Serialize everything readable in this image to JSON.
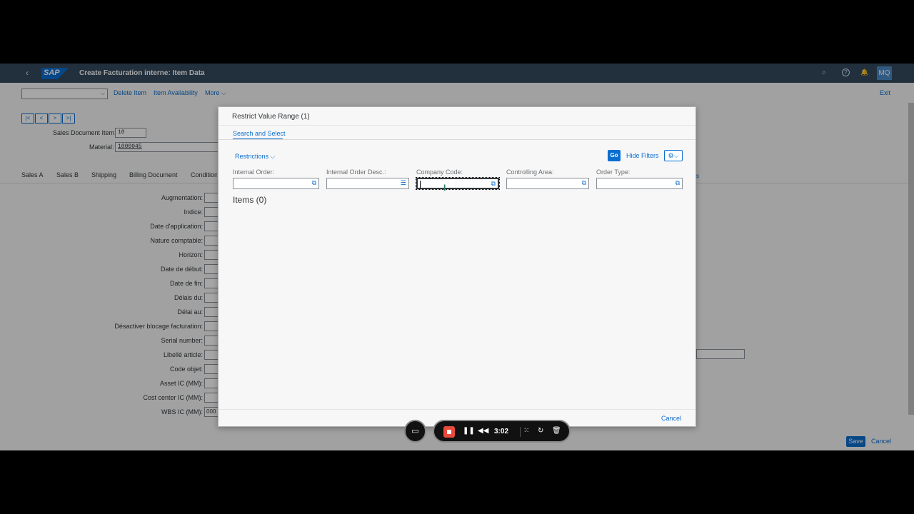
{
  "shell": {
    "back_icon": "‹",
    "logo": "SAP",
    "title": "Create Facturation interne: Item Data",
    "avatar": "MQ",
    "search_icon": "⌕",
    "help_icon": "?",
    "bell_icon": "🔔"
  },
  "toolbar": {
    "select_value": "",
    "buttons": [
      "Delete Item",
      "Item Availability",
      "More"
    ],
    "more_label": "More",
    "exit_label": "Exit"
  },
  "nav": {
    "first": "|<",
    "prev": "<",
    "next": ">",
    "last": ">|"
  },
  "header_fields": {
    "sales_doc_item_label": "Sales Document Item:",
    "sales_doc_item_value": "10",
    "material_label": "Material:",
    "material_value": "1000045"
  },
  "tabs": [
    "Sales A",
    "Sales B",
    "Shipping",
    "Billing Document",
    "Conditions"
  ],
  "form_fields": [
    {
      "label": "Augmentation:",
      "value": ""
    },
    {
      "label": "Indice:",
      "value": ""
    },
    {
      "label": "Date d'application:",
      "value": ""
    },
    {
      "label": "Nature comptable:",
      "value": ""
    },
    {
      "label": "Horizon:",
      "value": ""
    },
    {
      "label": "Date de début:",
      "value": ""
    },
    {
      "label": "Date de fin:",
      "value": ""
    },
    {
      "label": "Délais du:",
      "value": ""
    },
    {
      "label": "Délai au:",
      "value": ""
    },
    {
      "label": "Désactiver blocage facturation:",
      "value": ""
    },
    {
      "label": "Serial number:",
      "value": ""
    },
    {
      "label": "Libellé article:",
      "value": ""
    },
    {
      "label": "Code objet:",
      "value": ""
    },
    {
      "label": "Asset IC (MM):",
      "value": ""
    },
    {
      "label": "Cost center IC (MM):",
      "value": ""
    },
    {
      "label": "WBS IC (MM):",
      "value": "000"
    }
  ],
  "footer": {
    "save": "Save",
    "cancel": "Cancel"
  },
  "dialog": {
    "title": "Restrict Value Range (1)",
    "tab": "Search and Select",
    "restrictions": "Restrictions",
    "go": "Go",
    "hide_filters": "Hide Filters",
    "settings_icon": "⚙",
    "filters": [
      {
        "label": "Internal Order:",
        "value": "",
        "icon": "value-help-icon"
      },
      {
        "label": "Internal Order Desc.:",
        "value": "",
        "icon": "list-icon"
      },
      {
        "label": "Company Code:",
        "value": "",
        "icon": "value-help-icon"
      },
      {
        "label": "Controlling Area:",
        "value": "",
        "icon": "value-help-icon"
      },
      {
        "label": "Order Type:",
        "value": "",
        "icon": "value-help-icon"
      }
    ],
    "items_title": "Items (0)",
    "cancel": "Cancel"
  },
  "recorder": {
    "time": "3:02"
  }
}
